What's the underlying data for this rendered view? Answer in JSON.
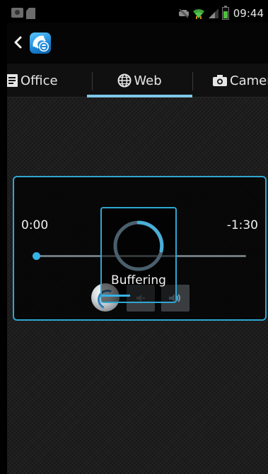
{
  "status_bar": {
    "time": "09:44",
    "left_icons": [
      "photo-notification-icon",
      "sim-card-icon"
    ],
    "right_icons": [
      "muted-icon",
      "wifi-icon",
      "signal-icon",
      "battery-icon"
    ],
    "battery_color": "#4fbf3d"
  },
  "action_bar": {
    "back_icon": "chevron-left-icon",
    "app_logo_icon": "app-logo-icon",
    "logo_color": "#1b86d6"
  },
  "tabs": [
    {
      "label": "Office",
      "icon": "document-icon",
      "selected": false
    },
    {
      "label": "Web",
      "icon": "globe-icon",
      "selected": true
    },
    {
      "label": "Camer",
      "icon": "camera-icon",
      "selected": false
    }
  ],
  "player": {
    "time_elapsed": "0:00",
    "time_remaining": "-1:30",
    "seek_progress": 0.0,
    "accent_color": "#2fa7d1",
    "buttons": [
      "voice-search-button",
      "volume-down-button",
      "volume-up-button"
    ]
  },
  "buffering": {
    "label": "Buffering",
    "spinner_color": "#4aaed8"
  }
}
